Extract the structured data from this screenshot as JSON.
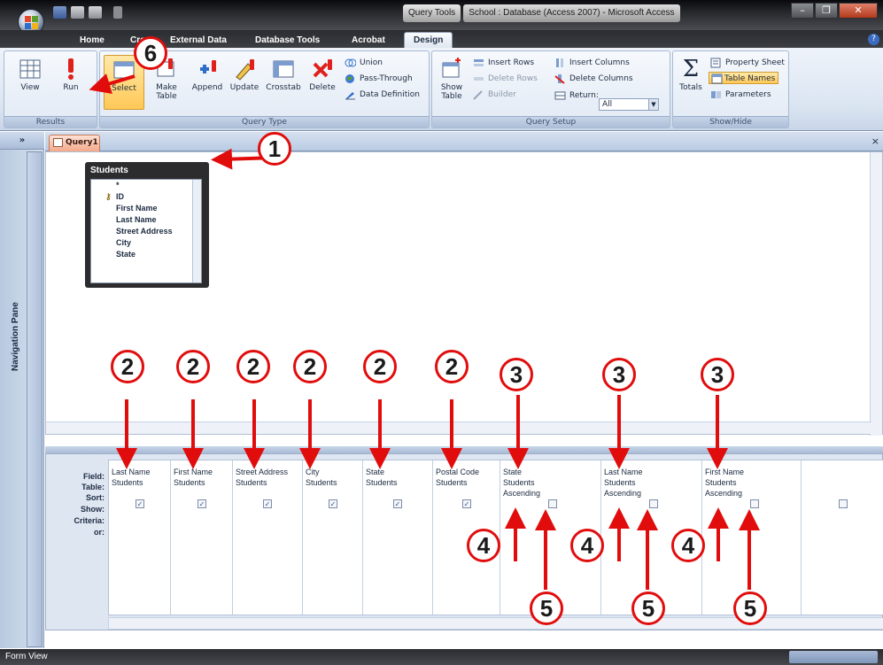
{
  "window": {
    "title_context": "Query Tools",
    "title_doc": "School : Database (Access 2007) - Microsoft Access"
  },
  "ribbon": {
    "tabs": [
      "Home",
      "Create",
      "External Data",
      "Database Tools",
      "Acrobat",
      "Design"
    ],
    "groups": {
      "results": {
        "label": "Results",
        "buttons": [
          "View",
          "Run"
        ]
      },
      "query_type": {
        "label": "Query Type",
        "buttons": [
          "Select",
          "Make\nTable",
          "Append",
          "Update",
          "Crosstab",
          "Delete"
        ],
        "small": [
          "Union",
          "Pass-Through",
          "Data Definition"
        ]
      },
      "query_setup": {
        "label": "Query Setup",
        "show_table": "Show\nTable",
        "small": [
          "Insert Rows",
          "Delete Rows",
          "Builder",
          "Insert Columns",
          "Delete Columns",
          "Return:"
        ],
        "return_value": "All"
      },
      "show_hide": {
        "label": "Show/Hide",
        "totals": "Totals",
        "small": [
          "Property Sheet",
          "Table Names",
          "Parameters"
        ]
      }
    }
  },
  "nav_pane": {
    "label": "Navigation Pane",
    "toggle": "»"
  },
  "document": {
    "tab": "Query1",
    "close": "×"
  },
  "table": {
    "title": "Students",
    "fields": [
      "*",
      "ID",
      "First Name",
      "Last Name",
      "Street Address",
      "City",
      "State"
    ]
  },
  "grid": {
    "row_labels": [
      "Field:",
      "Table:",
      "Sort:",
      "Show:",
      "Criteria:",
      "or:"
    ],
    "columns": [
      {
        "field": "Last Name",
        "table": "Students",
        "sort": "",
        "show": true
      },
      {
        "field": "First Name",
        "table": "Students",
        "sort": "",
        "show": true
      },
      {
        "field": "Street Address",
        "table": "Students",
        "sort": "",
        "show": true
      },
      {
        "field": "City",
        "table": "Students",
        "sort": "",
        "show": true
      },
      {
        "field": "State",
        "table": "Students",
        "sort": "",
        "show": true
      },
      {
        "field": "Postal Code",
        "table": "Students",
        "sort": "",
        "show": true
      },
      {
        "field": "State",
        "table": "Students",
        "sort": "Ascending",
        "show": false
      },
      {
        "field": "Last Name",
        "table": "Students",
        "sort": "Ascending",
        "show": false
      },
      {
        "field": "First Name",
        "table": "Students",
        "sort": "Ascending",
        "show": false
      },
      {
        "field": "",
        "table": "",
        "sort": "",
        "show": false
      }
    ]
  },
  "status_bar": {
    "text": "Form View"
  },
  "callouts": [
    "1",
    "2",
    "2",
    "2",
    "2",
    "2",
    "2",
    "3",
    "3",
    "3",
    "4",
    "4",
    "4",
    "5",
    "5",
    "5",
    "6"
  ],
  "colors": {
    "accent_red": "#e10d0d",
    "ribbon_blue": "#dbe5f2",
    "titlebar_dark": "#26282c"
  }
}
